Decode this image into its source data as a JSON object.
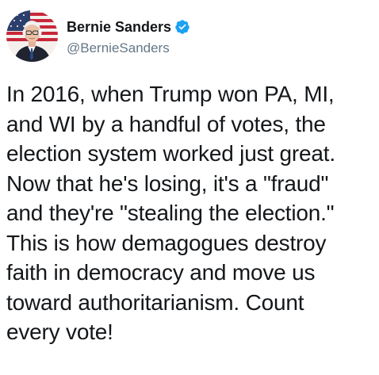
{
  "author": {
    "display_name": "Bernie Sanders",
    "handle": "@BernieSanders",
    "verified_icon": "verified-badge-icon",
    "verified_color": "#1da1f2"
  },
  "tweet": {
    "text": "In 2016, when Trump won PA, MI,\nand WI by a handful of votes, the\nelection system worked just great.\nNow that he's losing, it's a \"fraud\"\nand they're \"stealing the election.\"\nThis is how demagogues destroy\nfaith in democracy and move us\ntoward authoritarianism. Count\nevery vote!"
  },
  "colors": {
    "text": "#14171a",
    "secondary": "#657786",
    "background": "#ffffff"
  }
}
